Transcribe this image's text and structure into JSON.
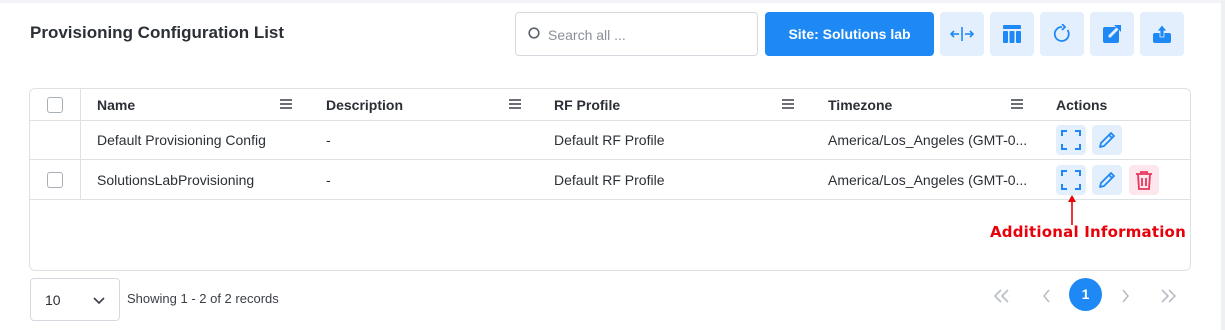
{
  "page": {
    "title": "Provisioning Configuration List"
  },
  "toolbar": {
    "search_placeholder": "Search all ...",
    "search_value": "",
    "site_label": "Site:  Solutions lab",
    "buttons": [
      {
        "icon": "expand-horizontal-icon"
      },
      {
        "icon": "columns-icon"
      },
      {
        "icon": "refresh-icon"
      },
      {
        "icon": "export-icon"
      },
      {
        "icon": "upload-icon"
      }
    ]
  },
  "table": {
    "columns": [
      "Name",
      "Description",
      "RF Profile",
      "Timezone",
      "Actions"
    ],
    "rows": [
      {
        "name": "Default Provisioning Config",
        "description": "-",
        "rf_profile": "Default RF Profile",
        "timezone": "America/Los_Angeles (GMT-0...",
        "has_checkbox": false,
        "actions": [
          "details",
          "edit"
        ]
      },
      {
        "name": "SolutionsLabProvisioning",
        "description": "-",
        "rf_profile": "Default RF Profile",
        "timezone": "America/Los_Angeles (GMT-0...",
        "has_checkbox": true,
        "actions": [
          "details",
          "edit",
          "delete"
        ]
      }
    ]
  },
  "annotation": {
    "text": "Additional Information",
    "color": "#e8000b"
  },
  "footer": {
    "page_size": "10",
    "records_text": "Showing 1 - 2 of 2 records",
    "current_page": "1"
  },
  "colors": {
    "primary": "#1e88f5",
    "action_bg": "#e3effc",
    "delete_bg": "#fde6ec",
    "delete_icon": "#e8365d"
  }
}
